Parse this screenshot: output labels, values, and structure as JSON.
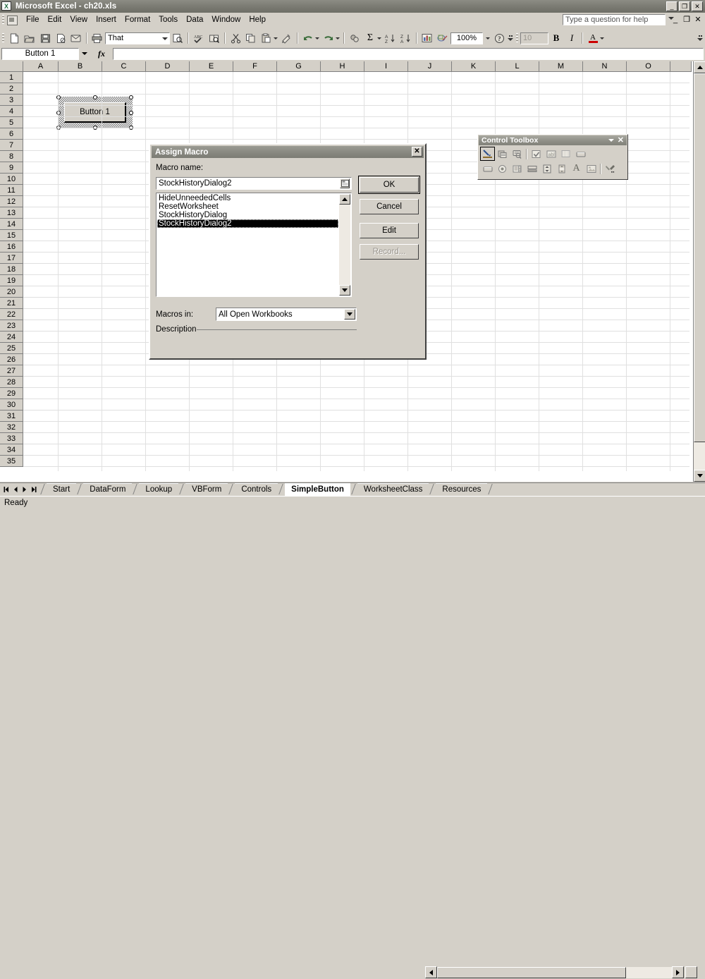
{
  "window": {
    "title": "Microsoft Excel - ch20.xls",
    "app_icon": "excel-icon",
    "minimize": "_",
    "maximize": "❐",
    "close": "✕"
  },
  "menubar": {
    "items": [
      {
        "label": "File",
        "accel": "F"
      },
      {
        "label": "Edit",
        "accel": "E"
      },
      {
        "label": "View",
        "accel": "V"
      },
      {
        "label": "Insert",
        "accel": "I"
      },
      {
        "label": "Format",
        "accel": "o"
      },
      {
        "label": "Tools",
        "accel": "T"
      },
      {
        "label": "Data",
        "accel": "D"
      },
      {
        "label": "Window",
        "accel": "W"
      },
      {
        "label": "Help",
        "accel": "H"
      }
    ],
    "ask_placeholder": "Type a question for help",
    "doc_minimize": "_",
    "doc_restore": "❐",
    "doc_close": "✕"
  },
  "toolbar": {
    "font_name": "That",
    "zoom": "100%",
    "font_size": "10",
    "bold_label": "B",
    "italic_label": "I",
    "font_color_label": "A",
    "buttons": [
      "new-icon",
      "open-icon",
      "save-icon",
      "permission-icon",
      "email-icon",
      "print-icon",
      "print-preview-icon",
      "spelling-icon",
      "research-icon",
      "cut-icon",
      "copy-icon",
      "paste-icon",
      "format-painter-icon",
      "undo-icon",
      "redo-icon",
      "hyperlink-icon",
      "autosum-icon",
      "sort-ascending-icon",
      "sort-descending-icon",
      "chart-wizard-icon",
      "drawing-icon",
      "help-icon"
    ]
  },
  "formula_bar": {
    "name_box": "Button 1",
    "fx_label": "fx",
    "formula": ""
  },
  "grid": {
    "columns": [
      "A",
      "B",
      "C",
      "D",
      "E",
      "F",
      "G",
      "H",
      "I",
      "J",
      "K",
      "L",
      "M",
      "N",
      "O"
    ],
    "rows": [
      1,
      2,
      3,
      4,
      5,
      6,
      7,
      8,
      9,
      10,
      11,
      12,
      13,
      14,
      15,
      16,
      17,
      18,
      19,
      20,
      21,
      22,
      23,
      24,
      25,
      26,
      27,
      28,
      29,
      30,
      31,
      32,
      33,
      34,
      35
    ],
    "sheet_button": {
      "label": "Button 1",
      "selected": true
    }
  },
  "assign_macro_dialog": {
    "title": "Assign Macro",
    "close_label": "✕",
    "macro_name_label": "Macro name:",
    "macro_name_value": "StockHistoryDialog2",
    "macro_list": [
      "HideUnneededCells",
      "ResetWorksheet",
      "StockHistoryDialog",
      "StockHistoryDialog2"
    ],
    "selected_macro": "StockHistoryDialog2",
    "macros_in_label": "Macros in:",
    "macros_in_value": "All Open Workbooks",
    "macros_in_options": [
      "All Open Workbooks"
    ],
    "description_label": "Description",
    "description_value": "",
    "buttons": [
      {
        "label": "OK",
        "name": "ok-button",
        "state": "default"
      },
      {
        "label": "Cancel",
        "name": "cancel-button",
        "state": "normal"
      },
      {
        "label": "Edit",
        "name": "edit-button",
        "state": "normal"
      },
      {
        "label": "Record...",
        "name": "record-button",
        "state": "disabled"
      }
    ]
  },
  "control_toolbox": {
    "title": "Control Toolbox",
    "close_label": "✕",
    "row1": [
      {
        "name": "design-mode-icon",
        "pressed": true
      },
      {
        "name": "properties-icon",
        "pressed": false
      },
      {
        "name": "view-code-icon",
        "pressed": false
      },
      {
        "name": "check-box-icon",
        "pressed": false
      },
      {
        "name": "text-box-icon",
        "pressed": false
      },
      {
        "name": "list-box-icon",
        "pressed": false
      },
      {
        "name": "command-button-icon",
        "pressed": false
      }
    ],
    "row2": [
      {
        "name": "command-button-icon",
        "pressed": false
      },
      {
        "name": "option-button-icon",
        "pressed": false
      },
      {
        "name": "combo-box-icon",
        "pressed": false
      },
      {
        "name": "toggle-button-icon",
        "pressed": false
      },
      {
        "name": "spin-button-icon",
        "pressed": false
      },
      {
        "name": "scroll-bar-icon",
        "pressed": false
      },
      {
        "name": "label-icon",
        "pressed": false
      },
      {
        "name": "image-icon",
        "pressed": false
      },
      {
        "name": "more-controls-icon",
        "pressed": false
      }
    ]
  },
  "sheet_tabs": {
    "tabs": [
      {
        "label": "Start",
        "active": false
      },
      {
        "label": "DataForm",
        "active": false
      },
      {
        "label": "Lookup",
        "active": false
      },
      {
        "label": "VBForm",
        "active": false
      },
      {
        "label": "Controls",
        "active": false
      },
      {
        "label": "SimpleButton",
        "active": true
      },
      {
        "label": "WorksheetClass",
        "active": false
      },
      {
        "label": "Resources",
        "active": false
      }
    ]
  },
  "status_bar": {
    "text": "Ready"
  }
}
